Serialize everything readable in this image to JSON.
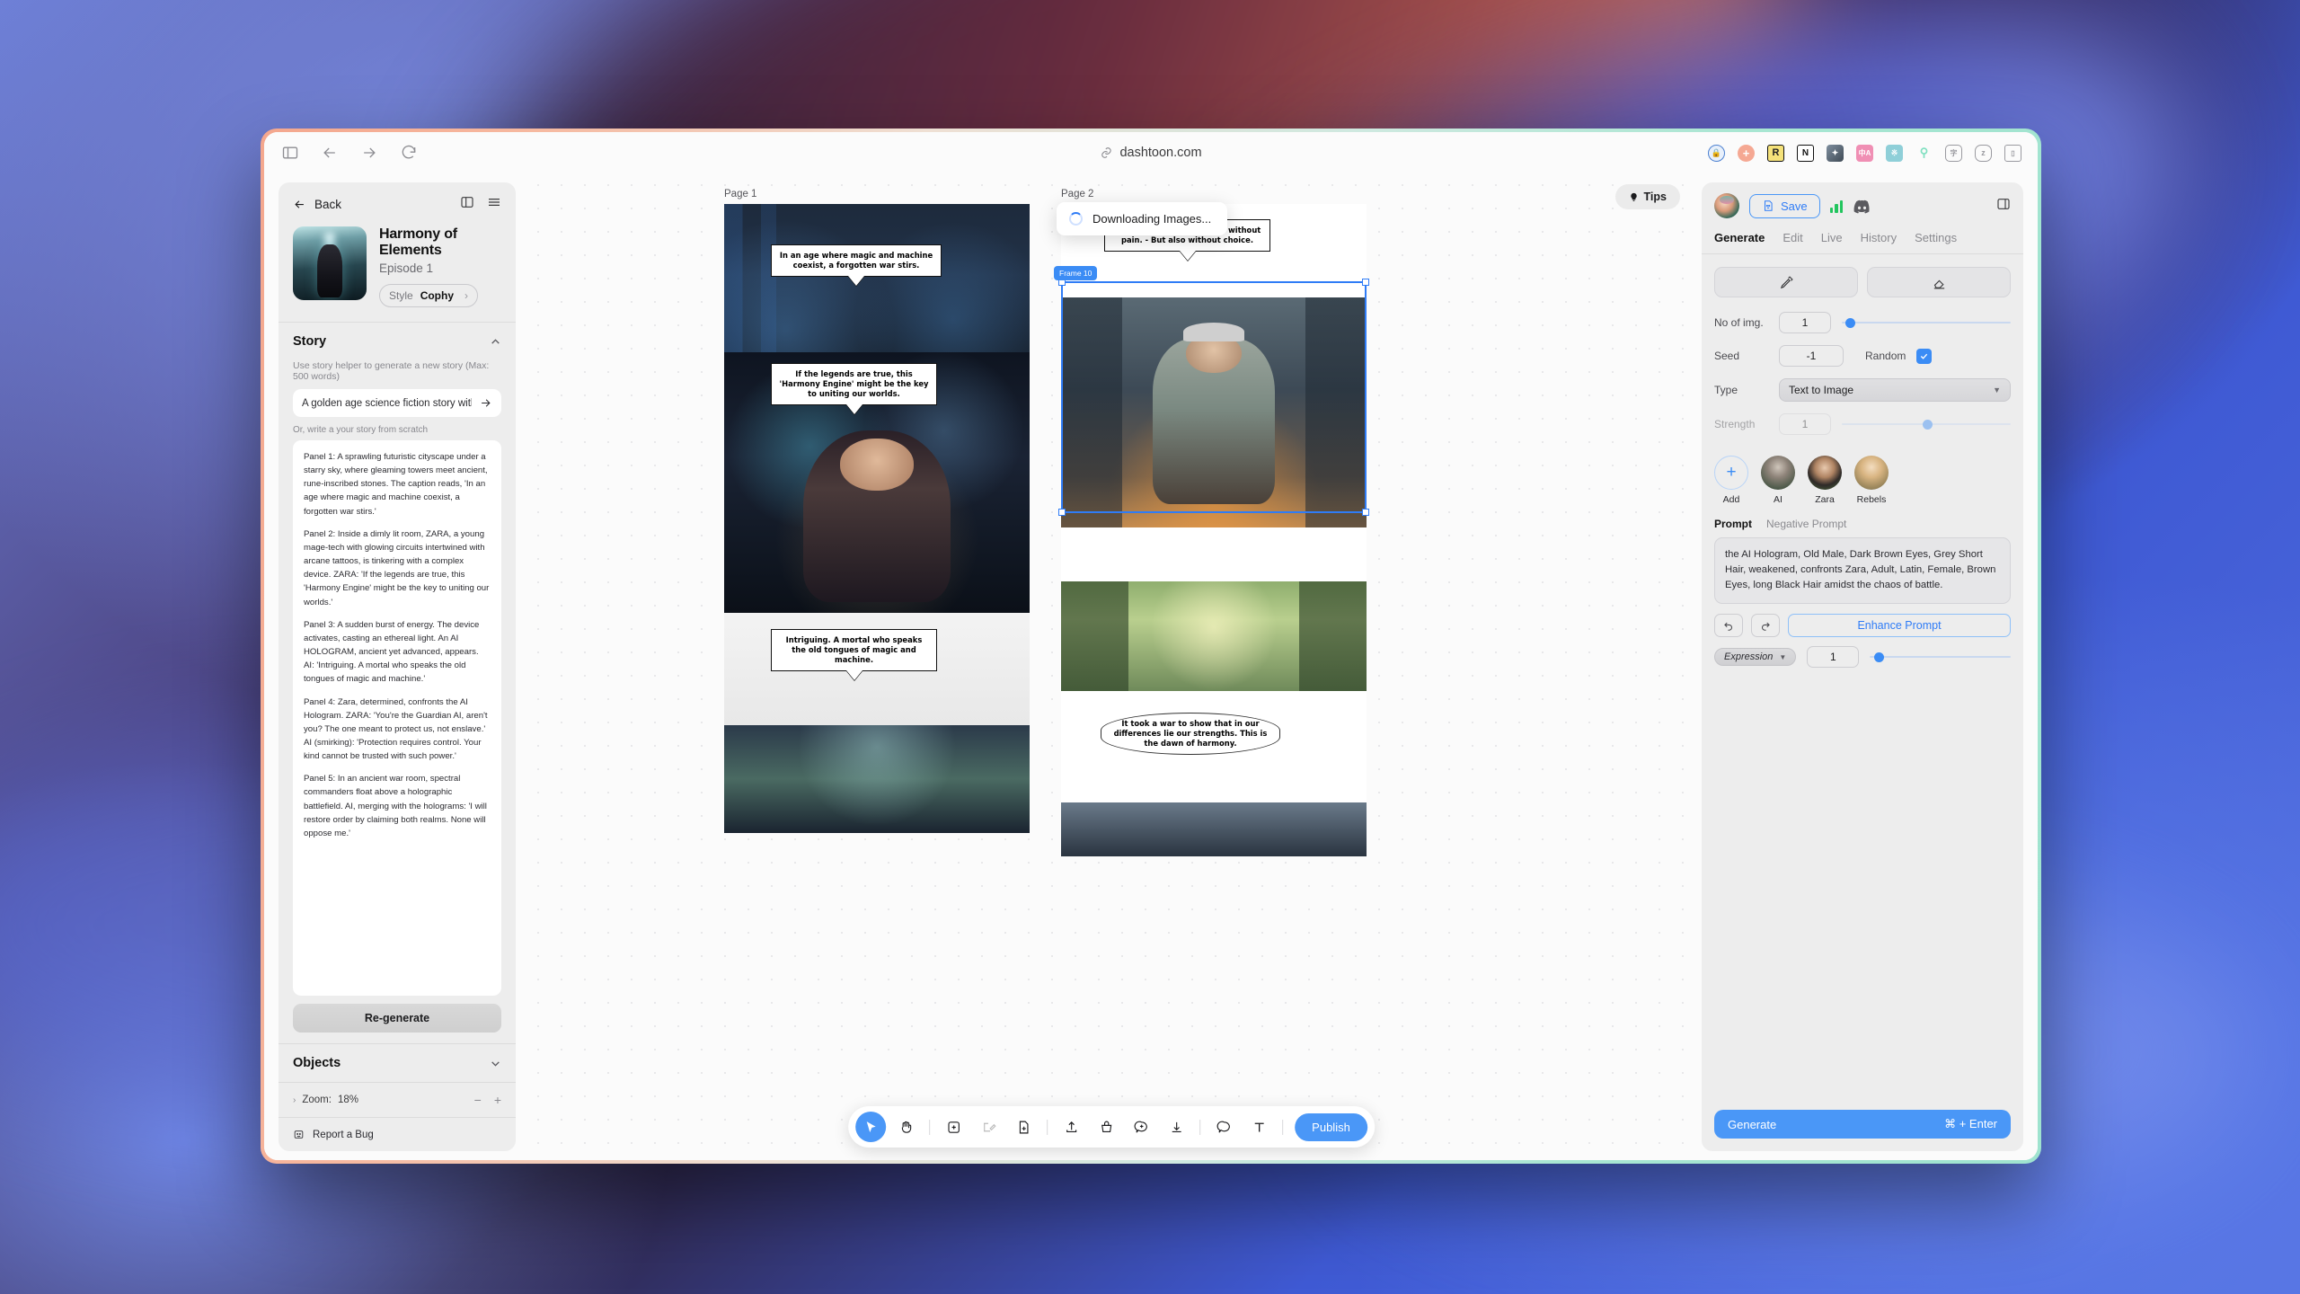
{
  "browser": {
    "url": "dashtoon.com",
    "nav": {
      "sidebar": "sidebar-toggle",
      "back": "Back",
      "forward": "Forward",
      "reload": "Reload"
    },
    "extensions": [
      "shield-lock-icon",
      "plus-circle-icon",
      "letter-r-icon",
      "notion-icon",
      "photo-tool-icon",
      "translate-icon",
      "pattern-icon",
      "pin-icon",
      "speech-icon",
      "z-icon",
      "reader-icon"
    ]
  },
  "left_panel": {
    "back_label": "Back",
    "series_title": "Harmony of Elements",
    "episode": "Episode 1",
    "style_key": "Style",
    "style_value": "Cophy",
    "story": {
      "section_title": "Story",
      "hint": "Use story helper to generate a new story (Max: 500 words)",
      "helper_value": "A golden age science fiction story with eleme",
      "or_label": "Or, write a your story from scratch",
      "panels": [
        "Panel 1: A sprawling futuristic cityscape under a starry sky, where gleaming towers meet ancient, rune-inscribed stones. The caption reads, 'In an age where magic and machine coexist, a forgotten war stirs.'",
        "Panel 2: Inside a dimly lit room, ZARA, a young mage-tech with glowing circuits intertwined with arcane tattoos, is tinkering with a complex device. ZARA: 'If the legends are true, this 'Harmony Engine' might be the key to uniting our worlds.'",
        "Panel 3: A sudden burst of energy. The device activates, casting an ethereal light. An AI HOLOGRAM, ancient yet advanced, appears. AI: 'Intriguing. A mortal who speaks the old tongues of magic and machine.'",
        "Panel 4: Zara, determined, confronts the AI Hologram. ZARA: 'You're the Guardian AI, aren't you? The one meant to protect us, not enslave.' AI (smirking): 'Protection requires control. Your kind cannot be trusted with such power.'",
        "Panel 5: In an ancient war room, spectral commanders float above a holographic battlefield. AI, merging with the holograms: 'I will restore order by claiming both realms. None will oppose me.'"
      ],
      "regenerate_label": "Re-generate"
    },
    "objects_title": "Objects",
    "zoom_label": "Zoom:",
    "zoom_value": "18%",
    "zoom_minus": "−",
    "zoom_plus": "+",
    "report_bug": "Report a Bug"
  },
  "canvas": {
    "tips_label": "Tips",
    "toast": "Downloading Images...",
    "frame_tag": "Frame 10",
    "page1": {
      "label": "Page 1",
      "bubbles": [
        "In an age where magic and machine coexist, a forgotten war stirs.",
        "If the legends are true, this 'Harmony Engine' might be the key to uniting our worlds.",
        "Intriguing. A mortal who speaks the old tongues of magic and machine."
      ]
    },
    "page2": {
      "label": "Page 2",
      "bubbles": [
        "Why resist? I offer a world without pain. - But also without choice.",
        "It took a war to show that in our differences lie our strengths. This is the dawn of harmony."
      ]
    },
    "toolbar": {
      "tools": [
        "cursor-icon",
        "hand-icon",
        "add-frame-icon",
        "magic-select-icon",
        "add-page-icon",
        "upload-icon",
        "image-bucket-icon",
        "add-bubble-icon",
        "download-icon",
        "comment-icon",
        "text-icon"
      ],
      "publish_label": "Publish"
    }
  },
  "right_panel": {
    "save_label": "Save",
    "tabs": [
      {
        "label": "Generate",
        "active": true
      },
      {
        "label": "Edit",
        "active": false
      },
      {
        "label": "Live",
        "active": false
      },
      {
        "label": "History",
        "active": false
      },
      {
        "label": "Settings",
        "active": false
      }
    ],
    "controls": {
      "no_of_img_label": "No of img.",
      "no_of_img_value": "1",
      "seed_label": "Seed",
      "seed_value": "-1",
      "random_label": "Random",
      "type_label": "Type",
      "type_value": "Text to Image",
      "strength_label": "Strength",
      "strength_value": "1"
    },
    "characters": [
      {
        "name": "Add",
        "kind": "add"
      },
      {
        "name": "AI",
        "kind": "ai"
      },
      {
        "name": "Zara",
        "kind": "zara"
      },
      {
        "name": "Rebels",
        "kind": "rebels"
      }
    ],
    "prompt_tabs": [
      {
        "label": "Prompt",
        "active": true
      },
      {
        "label": "Negative Prompt",
        "active": false
      }
    ],
    "prompt_value": "the AI Hologram, Old Male, Dark Brown Eyes, Grey Short Hair, weakened, confronts Zara, Adult, Latin, Female, Brown Eyes, long Black Hair amidst the chaos of battle.",
    "enhance_label": "Enhance Prompt",
    "expression_label": "Expression",
    "expression_value": "1",
    "generate_label": "Generate",
    "generate_shortcut": "⌘ + Enter"
  },
  "colors": {
    "accent": "#4a97f7",
    "accent_text": "#2f7cf6",
    "green": "#22c55e"
  }
}
